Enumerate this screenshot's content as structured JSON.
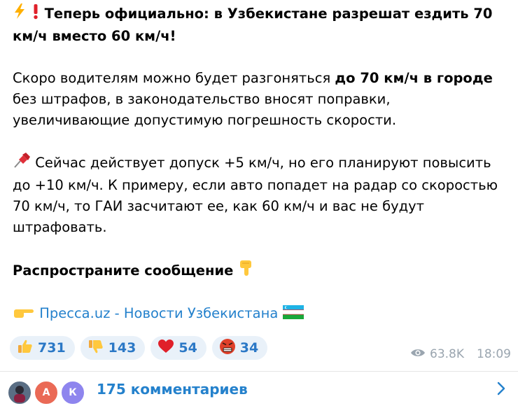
{
  "post": {
    "title": "Теперь официально: в Узбекистане разрешат ездить 70 км/ч вместо 60 км/ч!",
    "para1_a": "Скоро водителям можно будет разгоняться ",
    "para1_bold": "до 70 км/ч в городе",
    "para1_b": " без штрафов, в законодательство вносят поправки, увеличивающие допустимую погрешность скорости.",
    "para2": "Сейчас действует допуск +5 км/ч, но его планируют повысить до +10 км/ч. К примеру, если авто попадет на радар со скоростью 70 км/ч, то ГАИ засчитают ее, как 60 км/ч и вас не будут штрафовать.",
    "para3": "Распространите сообщение",
    "source_link": "Пресса.uz - Новости Узбекистана"
  },
  "reactions": [
    {
      "icon": "thumbs-up-icon",
      "count": "731"
    },
    {
      "icon": "thumbs-down-icon",
      "count": "143"
    },
    {
      "icon": "heart-icon",
      "count": "54"
    },
    {
      "icon": "angry-face-icon",
      "count": "34"
    }
  ],
  "meta": {
    "views": "63.8K",
    "time": "18:09"
  },
  "comments": {
    "label": "175 комментариев",
    "avatars": [
      {
        "letter": "А",
        "color": "#ea6a56"
      },
      {
        "letter": "К",
        "color": "#8e85ee"
      }
    ]
  },
  "colors": {
    "link": "#2481cc",
    "reaction_bg": "#e9f1f9",
    "reaction_text": "#2b78c6",
    "meta": "#9aa5af"
  }
}
